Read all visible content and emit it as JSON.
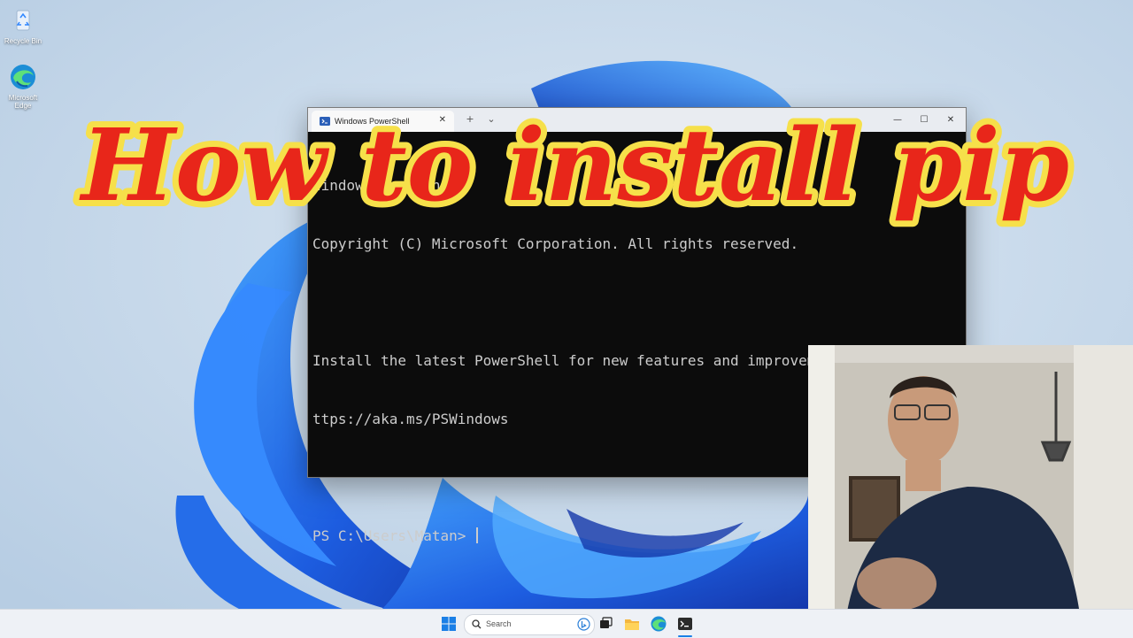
{
  "desktop": {
    "icons": [
      {
        "label": "Recycle Bin",
        "icon": "recycle-bin-icon"
      },
      {
        "label": "Microsoft Edge",
        "icon": "edge-icon"
      }
    ]
  },
  "terminal": {
    "tab_title": "Windows PowerShell",
    "tab_close": "✕",
    "new_tab": "+",
    "dropdown": "⌄",
    "minimize": "—",
    "maximize": "☐",
    "close": "✕",
    "lines": [
      "Windows PowerShell",
      "Copyright (C) Microsoft Corporation. All rights reserved.",
      "",
      "Install the latest PowerShell for new features and improvements! h",
      "ttps://aka.ms/PSWindows",
      "",
      "PS C:\\Users\\Matan> "
    ]
  },
  "overlay": {
    "headline": "How to install pip",
    "headline_fill": "#e8261a",
    "headline_outline": "#f6e04a"
  },
  "taskbar": {
    "search_placeholder": "Search",
    "items": [
      "start-icon",
      "search-icon",
      "task-view-icon",
      "file-explorer-icon",
      "edge-icon",
      "terminal-icon"
    ]
  },
  "colors": {
    "console_bg": "#0c0c0c",
    "console_text": "#cccccc",
    "wallpaper_bloom": "#1a5fe0"
  }
}
